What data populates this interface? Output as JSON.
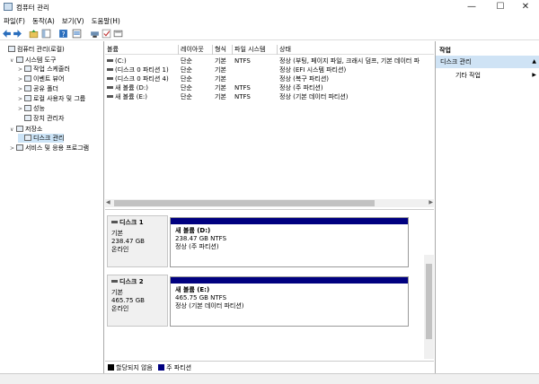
{
  "window": {
    "title": "컴퓨터 관리",
    "min": "—",
    "max": "☐",
    "close": "✕"
  },
  "menu": [
    "파일(F)",
    "동작(A)",
    "보기(V)",
    "도움말(H)"
  ],
  "toolbar_icons": [
    "back-icon",
    "forward-icon",
    "up-folder-icon",
    "show-hide-tree-icon",
    "help-icon",
    "properties-icon",
    "connect-icon",
    "check-icon",
    "view-icon"
  ],
  "tree": [
    {
      "label": "컴퓨터 관리(로컬)",
      "level": 0,
      "expander": "",
      "icon": "computer-icon",
      "selected": false
    },
    {
      "label": "시스템 도구",
      "level": 1,
      "expander": "∨",
      "icon": "tools-icon",
      "selected": false
    },
    {
      "label": "작업 스케줄러",
      "level": 2,
      "expander": ">",
      "icon": "clock-icon",
      "selected": false
    },
    {
      "label": "이벤트 뷰어",
      "level": 2,
      "expander": ">",
      "icon": "event-viewer-icon",
      "selected": false
    },
    {
      "label": "공유 폴더",
      "level": 2,
      "expander": ">",
      "icon": "shared-folder-icon",
      "selected": false
    },
    {
      "label": "로컬 사용자 및 그룹",
      "level": 2,
      "expander": ">",
      "icon": "users-icon",
      "selected": false
    },
    {
      "label": "성능",
      "level": 2,
      "expander": ">",
      "icon": "performance-icon",
      "selected": false
    },
    {
      "label": "장치 관리자",
      "level": 2,
      "expander": "",
      "icon": "device-manager-icon",
      "selected": false
    },
    {
      "label": "저장소",
      "level": 1,
      "expander": "∨",
      "icon": "storage-icon",
      "selected": false
    },
    {
      "label": "디스크 관리",
      "level": 2,
      "expander": "",
      "icon": "disk-management-icon",
      "selected": true
    },
    {
      "label": "서비스 및 응용 프로그램",
      "level": 1,
      "expander": ">",
      "icon": "services-icon",
      "selected": false
    }
  ],
  "columns": [
    "볼륨",
    "레이아웃",
    "형식",
    "파일 시스템",
    "상태"
  ],
  "volumes": [
    {
      "name": "(C:)",
      "layout": "단순",
      "type": "기본",
      "fs": "NTFS",
      "status": "정상 (부팅, 페이지 파일, 크래시 덤프, 기본 데이터 파"
    },
    {
      "name": "(디스크 0 파티션 1)",
      "layout": "단순",
      "type": "기본",
      "fs": "",
      "status": "정상 (EFI 시스템 파티션)"
    },
    {
      "name": "(디스크 0 파티션 4)",
      "layout": "단순",
      "type": "기본",
      "fs": "",
      "status": "정상 (복구 파티션)"
    },
    {
      "name": "새 볼륨 (D:)",
      "layout": "단순",
      "type": "기본",
      "fs": "NTFS",
      "status": "정상 (주 파티션)"
    },
    {
      "name": "새 볼륨 (E:)",
      "layout": "단순",
      "type": "기본",
      "fs": "NTFS",
      "status": "정상 (기본 데이터 파티션)"
    }
  ],
  "disks": [
    {
      "name": "디스크 1",
      "kind": "기본",
      "size": "238.47 GB",
      "state": "온라인",
      "part_name": "새 볼륨 (D:)",
      "part_size": "238.47 GB NTFS",
      "part_status": "정상 (주 파티션)"
    },
    {
      "name": "디스크 2",
      "kind": "기본",
      "size": "465.75 GB",
      "state": "온라인",
      "part_name": "새 볼륨 (E:)",
      "part_size": "465.75 GB NTFS",
      "part_status": "정상 (기본 데이터 파티션)"
    }
  ],
  "legend": [
    {
      "label": "할당되지 않음",
      "color": "#000000"
    },
    {
      "label": "주 파티션",
      "color": "#000080"
    }
  ],
  "actions": {
    "header": "작업",
    "section": "디스크 관리",
    "section_arrow": "▲",
    "more": "기타 작업",
    "more_arrow": "▶"
  }
}
